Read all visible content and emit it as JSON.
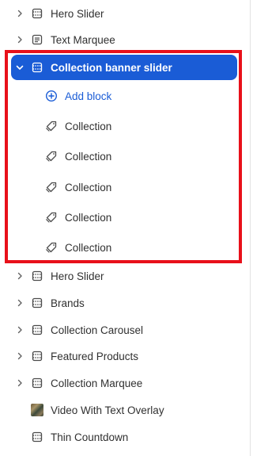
{
  "tree": {
    "before": [
      {
        "label": "Hero Slider",
        "icon": "section-icon",
        "expandable": true
      },
      {
        "label": "Text Marquee",
        "icon": "text-icon",
        "expandable": true
      }
    ],
    "selected": {
      "label": "Collection banner slider",
      "icon": "section-icon",
      "expanded": true
    },
    "add_block_label": "Add block",
    "children": [
      {
        "label": "Collection",
        "icon": "tag-icon"
      },
      {
        "label": "Collection",
        "icon": "tag-icon"
      },
      {
        "label": "Collection",
        "icon": "tag-icon"
      },
      {
        "label": "Collection",
        "icon": "tag-icon"
      },
      {
        "label": "Collection",
        "icon": "tag-icon"
      }
    ],
    "after": [
      {
        "label": "Hero Slider",
        "icon": "section-icon",
        "expandable": true
      },
      {
        "label": "Brands",
        "icon": "section-icon",
        "expandable": true
      },
      {
        "label": "Collection Carousel",
        "icon": "section-icon",
        "expandable": true
      },
      {
        "label": "Featured Products",
        "icon": "section-icon",
        "expandable": true
      },
      {
        "label": "Collection Marquee",
        "icon": "section-icon",
        "expandable": true
      },
      {
        "label": "Video With Text Overlay",
        "icon": "video-thumbnail-icon",
        "expandable": false
      },
      {
        "label": "Thin Countdown",
        "icon": "section-icon",
        "expandable": false
      }
    ]
  },
  "colors": {
    "accent": "#1a5cd6",
    "highlight": "#e8101a"
  }
}
